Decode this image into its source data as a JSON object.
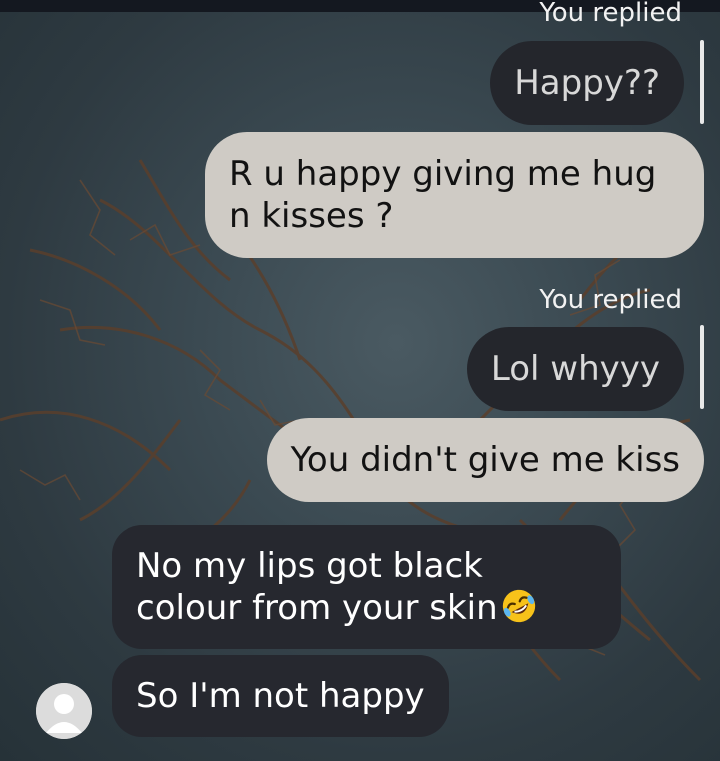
{
  "thread": {
    "reply_label_1": "You replied",
    "quoted_1": "Happy??",
    "sent_1": "R u happy giving me hug n kisses ?",
    "reply_label_2": "You replied",
    "quoted_2": "Lol whyyy",
    "sent_2": "You didn't give me kiss",
    "received_1": "No my lips got black colour from your skin",
    "received_1_emoji": "rolling-on-floor-laughing",
    "received_2": "So I'm not happy"
  },
  "colors": {
    "sent_bubble": "#cfcbc5",
    "received_bubble": "#26282f",
    "quoted_bubble": "#24262c"
  }
}
